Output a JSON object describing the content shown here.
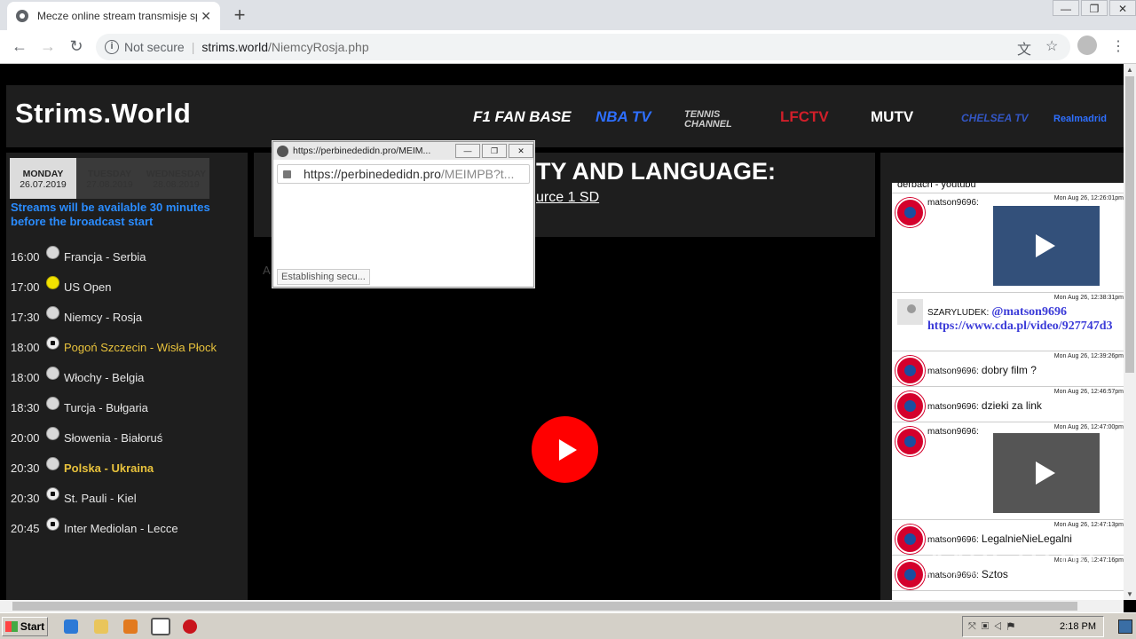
{
  "browser": {
    "tab_title": "Mecze online stream transmisje sport",
    "tab_close": "✕",
    "new_tab": "+",
    "security": "Not secure",
    "url_host": "strims.world",
    "url_path": "/NiemcyRosja.php",
    "window_controls": [
      "—",
      "❐",
      "✕"
    ]
  },
  "site": {
    "logo": "Strims.World",
    "channels": [
      {
        "label": "F1 FAN BASE",
        "color": "#ffffff"
      },
      {
        "label": "NBA TV",
        "color": "#2e6fff"
      },
      {
        "label": "TENNIS CHANNEL",
        "color": "#cccccc"
      },
      {
        "label": "LFCTV",
        "color": "#d11f2a"
      },
      {
        "label": "MUTV",
        "color": "#ffffff"
      },
      {
        "label": "CHELSEA TV",
        "color": "#1b3d9a"
      },
      {
        "label": "Realmadrid",
        "color": "#2e6fff"
      }
    ]
  },
  "schedule": {
    "days": [
      {
        "name": "MONDAY",
        "date": "26.07.2019"
      },
      {
        "name": "TUESDAY",
        "date": "27.08.2019"
      },
      {
        "name": "WEDNESDAY",
        "date": "28.08.2019"
      }
    ],
    "notice": "Streams will be available 30 minutes before the broadcast start",
    "matches": [
      {
        "time": "16:00",
        "icon": "tennis-ball-icon",
        "teams": "Francja - Serbia"
      },
      {
        "time": "17:00",
        "icon": "tennis-ball-icon",
        "teams": "US Open"
      },
      {
        "time": "17:30",
        "icon": "tennis-ball-icon",
        "teams": "Niemcy - Rosja"
      },
      {
        "time": "18:00",
        "icon": "soccer-ball-icon",
        "teams": "Pogoń Szczecin - Wisła Płock"
      },
      {
        "time": "18:00",
        "icon": "tennis-ball-icon",
        "teams": "Włochy - Belgia"
      },
      {
        "time": "18:30",
        "icon": "tennis-ball-icon",
        "teams": "Turcja - Bułgaria"
      },
      {
        "time": "20:00",
        "icon": "tennis-ball-icon",
        "teams": "Słowenia - Białoruś"
      },
      {
        "time": "20:30",
        "icon": "tennis-ball-icon",
        "teams": "Polska - Ukraina"
      },
      {
        "time": "20:30",
        "icon": "soccer-ball-icon",
        "teams": "St. Pauli - Kiel"
      },
      {
        "time": "20:45",
        "icon": "soccer-ball-icon",
        "teams": "Inter Mediolan - Lecce"
      }
    ]
  },
  "main": {
    "heading": "TY AND LANGUAGE:",
    "source": "urce 1 SD"
  },
  "chat": {
    "top_cut": "derbach - youtubu",
    "messages": [
      {
        "time": "Mon Aug 26, 12:26:01pm",
        "nick": "matson9696:",
        "text": ""
      },
      {
        "time": "Mon Aug 26, 12:38:31pm",
        "nick": "SZARYLUDEK:",
        "text": "@matson9696 https://www.cda.pl/video/927747d3"
      },
      {
        "time": "Mon Aug 26, 12:39:26pm",
        "nick": "matson9696:",
        "text": "dobry film ?"
      },
      {
        "time": "Mon Aug 26, 12:46:57pm",
        "nick": "matson9696:",
        "text": "dzieki za link"
      },
      {
        "time": "Mon Aug 26, 12:47:00pm",
        "nick": "matson9696:",
        "text": ""
      },
      {
        "time": "Mon Aug 26, 12:47:13pm",
        "nick": "matson9696:",
        "text": "LegalnieNieLegalni"
      },
      {
        "time": "Mon Aug 26, 12:47:16pm",
        "nick": "matson9696:",
        "text": "Sztos"
      }
    ]
  },
  "popup": {
    "title": "https://perbinededidn.pro/MEIM...",
    "url_host": "https://perbinededidn.pro",
    "url_path": "/MEIMPB?t...",
    "status": "Establishing secu..."
  },
  "watermark": "ANY RUN",
  "taskbar": {
    "start": "Start",
    "clock": "2:18 PM"
  }
}
